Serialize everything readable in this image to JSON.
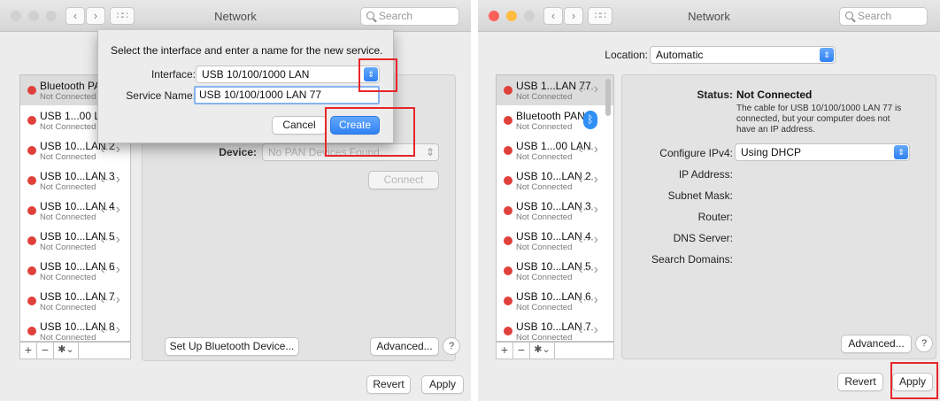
{
  "left_window": {
    "title": "Network",
    "search_placeholder": "Search",
    "services": [
      {
        "name": "Bluetooth PAN",
        "status": "Not Connected"
      },
      {
        "name": "USB 1...00 LAN",
        "status": "Not Connected"
      },
      {
        "name": "USB 10...LAN 2",
        "status": "Not Connected"
      },
      {
        "name": "USB 10...LAN 3",
        "status": "Not Connected"
      },
      {
        "name": "USB 10...LAN 4",
        "status": "Not Connected"
      },
      {
        "name": "USB 10...LAN 5",
        "status": "Not Connected"
      },
      {
        "name": "USB 10...LAN 6",
        "status": "Not Connected"
      },
      {
        "name": "USB 10...LAN 7",
        "status": "Not Connected"
      },
      {
        "name": "USB 10...LAN 8",
        "status": "Not Connected"
      }
    ],
    "footer": {
      "add": "+",
      "remove": "−",
      "gear": "✱⌄"
    },
    "device_label": "Device:",
    "device_value": "No PAN Devices Found",
    "connect_label": "Connect",
    "setup_bluetooth_label": "Set Up Bluetooth Device...",
    "advanced_label": "Advanced...",
    "help_label": "?",
    "revert_label": "Revert",
    "apply_label": "Apply",
    "sheet": {
      "prompt": "Select the interface and enter a name for the new service.",
      "interface_label": "Interface:",
      "interface_value": "USB 10/100/1000 LAN",
      "service_name_label": "Service Name:",
      "service_name_value": "USB 10/100/1000 LAN 77",
      "cancel_label": "Cancel",
      "create_label": "Create"
    }
  },
  "right_window": {
    "title": "Network",
    "search_placeholder": "Search",
    "location_label": "Location:",
    "location_value": "Automatic",
    "services": [
      {
        "name": "USB 1...LAN 77",
        "status": "Not Connected",
        "icon": "ethernet-icon"
      },
      {
        "name": "Bluetooth PAN",
        "status": "Not Connected",
        "icon": "bluetooth-icon"
      },
      {
        "name": "USB 1...00 LAN",
        "status": "Not Connected",
        "icon": "ethernet-icon"
      },
      {
        "name": "USB 10...LAN 2",
        "status": "Not Connected",
        "icon": "ethernet-icon"
      },
      {
        "name": "USB 10...LAN 3",
        "status": "Not Connected",
        "icon": "ethernet-icon"
      },
      {
        "name": "USB 10...LAN 4",
        "status": "Not Connected",
        "icon": "ethernet-icon"
      },
      {
        "name": "USB 10...LAN 5",
        "status": "Not Connected",
        "icon": "ethernet-icon"
      },
      {
        "name": "USB 10...LAN 6",
        "status": "Not Connected",
        "icon": "ethernet-icon"
      },
      {
        "name": "USB 10...LAN 7",
        "status": "Not Connected",
        "icon": "ethernet-icon"
      }
    ],
    "status_label": "Status:",
    "status_value": "Not Connected",
    "status_detail": "The cable for USB 10/100/1000 LAN 77 is connected, but your computer does not have an IP address.",
    "configure_label": "Configure IPv4:",
    "configure_value": "Using DHCP",
    "ip_label": "IP Address:",
    "subnet_label": "Subnet Mask:",
    "router_label": "Router:",
    "dns_label": "DNS Server:",
    "search_domains_label": "Search Domains:",
    "advanced_label": "Advanced...",
    "help_label": "?",
    "revert_label": "Revert",
    "apply_label": "Apply"
  },
  "colors": {
    "highlight_box": "#e8262a",
    "accent_blue": "#2f82f3",
    "status_dot": "#e0403a"
  }
}
